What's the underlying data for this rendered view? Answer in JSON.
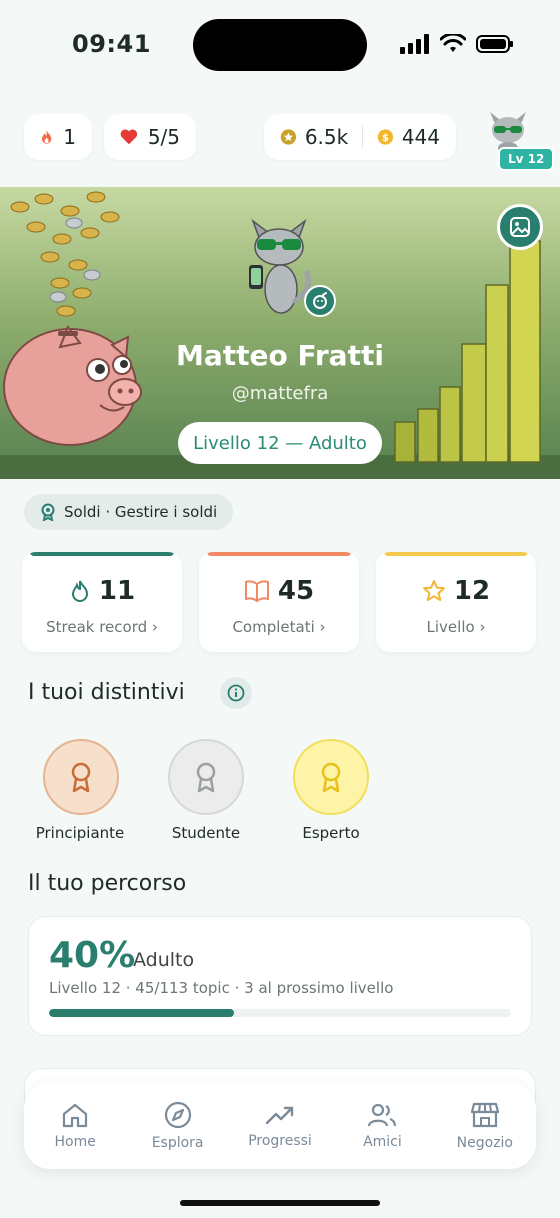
{
  "status": {
    "time": "09:41"
  },
  "topbar": {
    "streak": "1",
    "lives": "5/5",
    "xp": "6.5k",
    "coins": "444",
    "level_badge": "Lv 12"
  },
  "profile": {
    "name": "Matteo Fratti",
    "handle": "@mattefra",
    "level_label": "Livello 12 — Adulto"
  },
  "topic": {
    "label": "Soldi · Gestire i soldi"
  },
  "stats": [
    {
      "value": "11",
      "label": "Streak record ›",
      "icon": "flame-icon",
      "color": "#2a7e6e"
    },
    {
      "value": "45",
      "label": "Completati ›",
      "icon": "book-icon",
      "color": "#ef8a64"
    },
    {
      "value": "12",
      "label": "Livello ›",
      "icon": "star-icon",
      "color": "#f2c94c"
    }
  ],
  "badges": {
    "title": "I tuoi distintivi",
    "items": [
      {
        "label": "Principiante",
        "color": "#c96d36"
      },
      {
        "label": "Studente",
        "color": "#9aa1a0"
      },
      {
        "label": "Esperto",
        "color": "#e8c21a"
      }
    ]
  },
  "journey": {
    "title": "Il tuo percorso",
    "percent": "40%",
    "progress": 0.4,
    "stage": "Adulto",
    "meta": "Livello 12 · 45/113 topic · 3 al prossimo livello"
  },
  "tabs": [
    {
      "label": "Home",
      "icon": "home-icon"
    },
    {
      "label": "Esplora",
      "icon": "compass-icon"
    },
    {
      "label": "Progressi",
      "icon": "trend-icon"
    },
    {
      "label": "Amici",
      "icon": "friends-icon"
    },
    {
      "label": "Negozio",
      "icon": "shop-icon"
    }
  ],
  "colors": {
    "accent": "#2a7e6e",
    "level_pill_text": "#2a8c75"
  }
}
